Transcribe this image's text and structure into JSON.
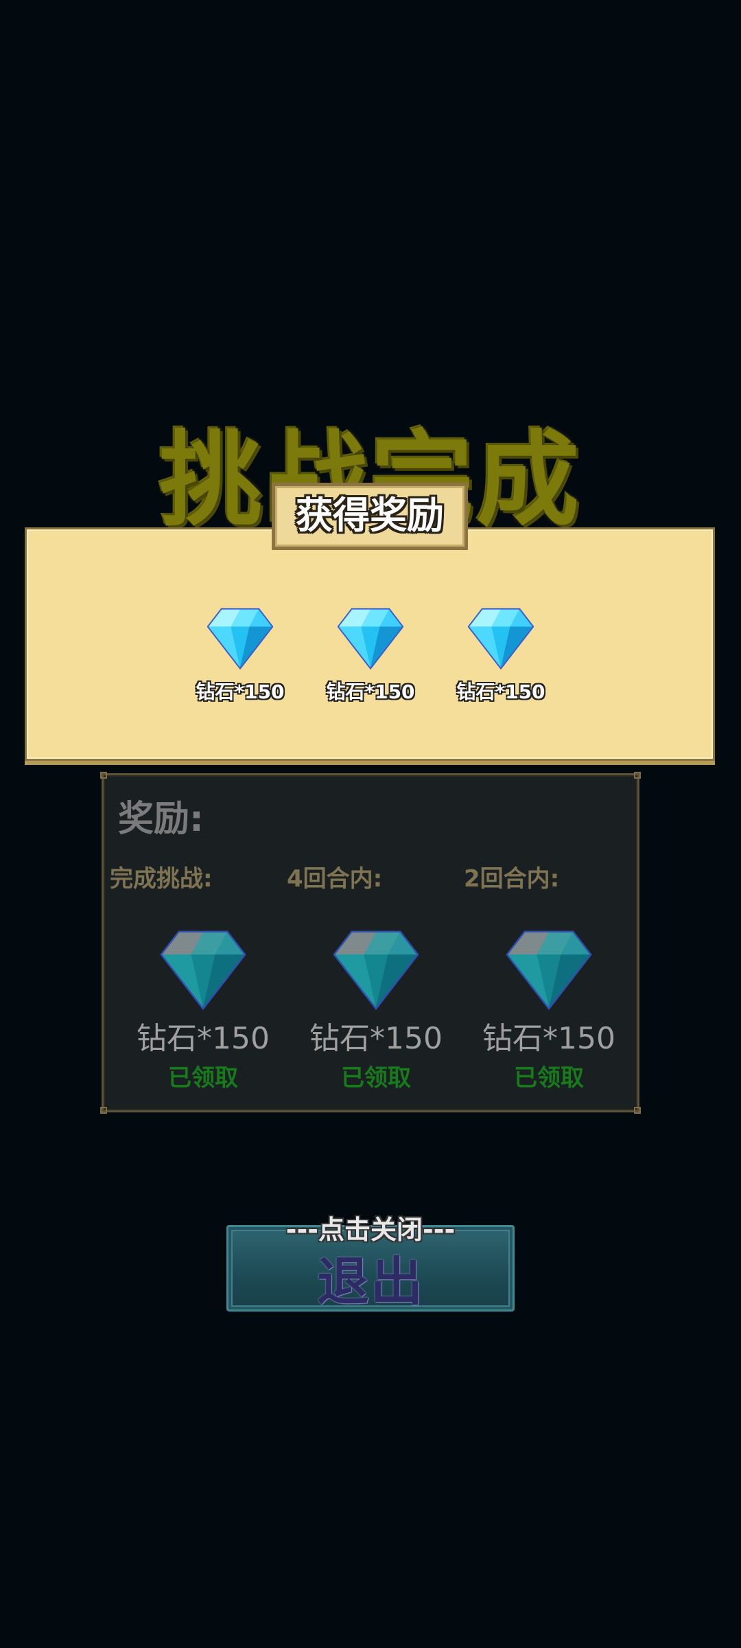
{
  "title": "挑战完成",
  "reward_popup": {
    "header": "获得奖励",
    "items": [
      {
        "icon": "diamond-icon",
        "label": "钻石*150"
      },
      {
        "icon": "diamond-icon",
        "label": "钻石*150"
      },
      {
        "icon": "diamond-icon",
        "label": "钻石*150"
      }
    ]
  },
  "rewards_info": {
    "title": "奖励:",
    "columns": [
      {
        "condition": "完成挑战:",
        "icon": "diamond-icon",
        "amount": "钻石*150",
        "status": "已领取"
      },
      {
        "condition": "4回合内:",
        "icon": "diamond-icon",
        "amount": "钻石*150",
        "status": "已领取"
      },
      {
        "condition": "2回合内:",
        "icon": "diamond-icon",
        "amount": "钻石*150",
        "status": "已领取"
      }
    ]
  },
  "exit_button": {
    "label": "退出",
    "hint": "---点击关闭---"
  },
  "colors": {
    "background": "#020a10",
    "panel_light": "#f5dd9a",
    "panel_dark": "#1a1f22",
    "status_green": "#177b1c",
    "title_olive": "#7d7a0c",
    "button_teal": "#1d4a55"
  }
}
